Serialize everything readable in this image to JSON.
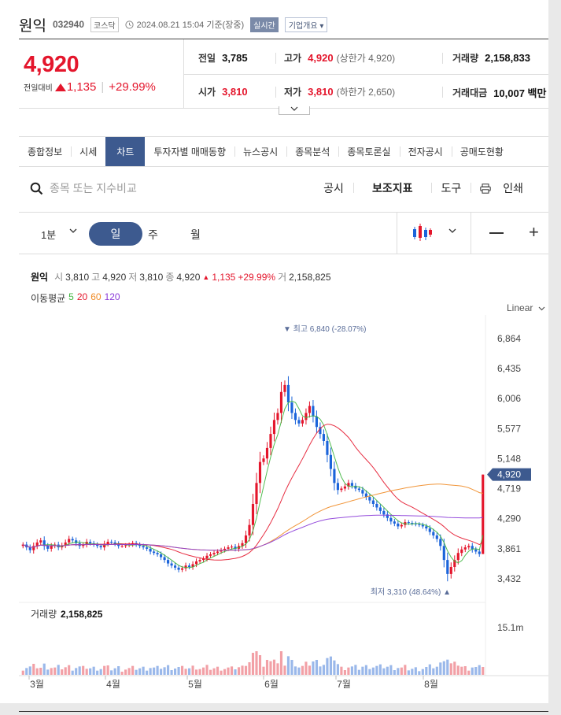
{
  "stock": {
    "name": "원익",
    "code": "032940",
    "market": "코스닥",
    "datetime": "2024.08.21 15:04 기준(장중)",
    "live": "실시간",
    "company_info": "기업개요",
    "price": "4,920",
    "change_label": "전일대비",
    "change": "1,135",
    "change_pct": "+29.99%"
  },
  "summary": {
    "prev_close_label": "전일",
    "prev_close": "3,785",
    "high_label": "고가",
    "high": "4,920",
    "upper_limit": "(상한가 4,920)",
    "volume_label": "거래량",
    "volume": "2,158,833",
    "open_label": "시가",
    "open": "3,810",
    "low_label": "저가",
    "low": "3,810",
    "lower_limit": "(하한가 2,650)",
    "amount_label": "거래대금",
    "amount": "10,007 백만"
  },
  "tabs": [
    "종합정보",
    "시세",
    "차트",
    "투자자별 매매동향",
    "뉴스공시",
    "종목분석",
    "종목토론실",
    "전자공시",
    "공매도현황"
  ],
  "active_tab": "차트",
  "toolbar": {
    "search_placeholder": "종목 또는 지수비교",
    "disclosure": "공시",
    "indicator": "보조지표",
    "tools": "도구",
    "print": "인쇄"
  },
  "periods": {
    "minute": "1분",
    "day": "일",
    "week": "주",
    "month": "월"
  },
  "legend": {
    "name": "원익",
    "o_label": "시",
    "o": "3,810",
    "h_label": "고",
    "h": "4,920",
    "l_label": "저",
    "l": "3,810",
    "c_label": "종",
    "c": "4,920",
    "chg": "1,135",
    "chg_pct": "+29.99%",
    "v_label": "거",
    "v": "2,158,825",
    "ma_label": "이동평균",
    "ma": [
      {
        "label": "5",
        "color": "#3eb53e"
      },
      {
        "label": "20",
        "color": "#e4162c"
      },
      {
        "label": "60",
        "color": "#f08a24"
      },
      {
        "label": "120",
        "color": "#8a3ad8"
      }
    ],
    "scale": "Linear"
  },
  "colors": {
    "up": "#e4162c",
    "down": "#1b64da",
    "accent": "#3d5a8f"
  },
  "chart_data": {
    "type": "candlestick",
    "y_ticks": [
      "6,864",
      "6,435",
      "6,006",
      "5,577",
      "5,148",
      "4,719",
      "4,290",
      "3,861",
      "3,432"
    ],
    "y_tick_values": [
      6864,
      6435,
      6006,
      5577,
      5148,
      4719,
      4290,
      3861,
      3432
    ],
    "ylim": [
      3150,
      7200
    ],
    "x_ticks": [
      "3월",
      "4월",
      "5월",
      "6월",
      "7월",
      "8월"
    ],
    "current_price": "4,920",
    "current_price_value": 4920,
    "high_annotation": "최고 6,840 (-28.07%)",
    "high_value": 6840,
    "low_annotation": "최저 3,310 (48.64%)",
    "low_value": 3310,
    "volume_label": "거래량",
    "volume_value": "2,158,825",
    "volume_axis": "15.1m",
    "close": [
      3920,
      3880,
      3840,
      3900,
      3950,
      3980,
      3900,
      3860,
      3900,
      3920,
      3880,
      3910,
      3950,
      4000,
      3980,
      3940,
      3900,
      3920,
      3960,
      3940,
      3920,
      3900,
      3880,
      3930,
      3960,
      3950,
      3930,
      3900,
      3900,
      3910,
      3920,
      3940,
      3920,
      3900,
      3880,
      3860,
      3820,
      3800,
      3780,
      3740,
      3700,
      3650,
      3620,
      3590,
      3560,
      3580,
      3620,
      3600,
      3640,
      3680,
      3700,
      3720,
      3760,
      3780,
      3800,
      3820,
      3840,
      3860,
      3880,
      3890,
      3860,
      3900,
      3940,
      4050,
      4200,
      4500,
      4800,
      5100,
      5150,
      5300,
      5500,
      5700,
      5800,
      6100,
      6200,
      5950,
      5800,
      5700,
      5650,
      5700,
      5800,
      5900,
      5750,
      5600,
      5500,
      5400,
      5200,
      5000,
      4800,
      4700,
      4720,
      4750,
      4800,
      4760,
      4720,
      4700,
      4650,
      4600,
      4550,
      4500,
      4450,
      4400,
      4350,
      4300,
      4250,
      4220,
      4180,
      4200,
      4240,
      4230,
      4220,
      4210,
      4200,
      4180,
      4150,
      4100,
      4050,
      4000,
      3900,
      3700,
      3500,
      3600,
      3700,
      3800,
      3850,
      3880,
      3900,
      3850,
      3820,
      3785,
      4920
    ]
  }
}
